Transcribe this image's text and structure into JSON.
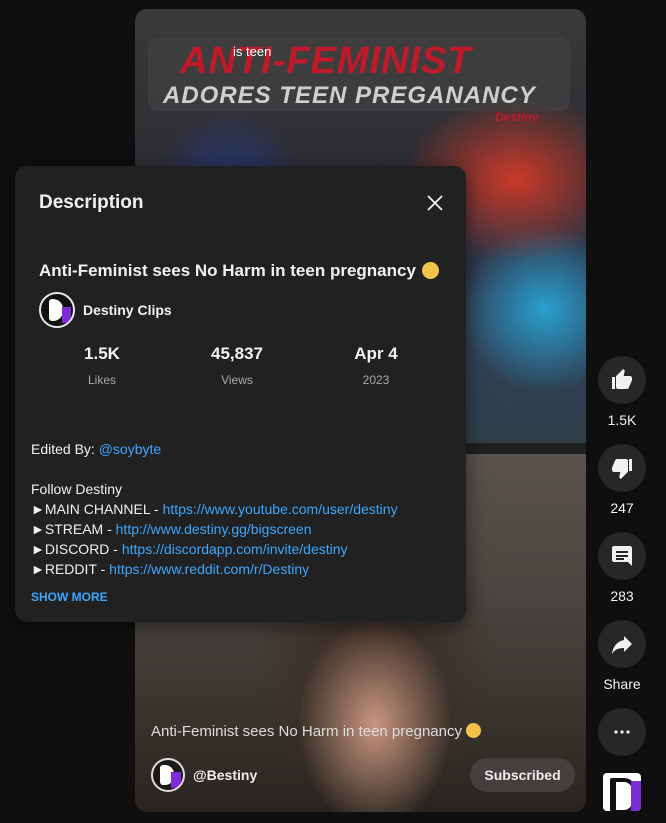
{
  "video": {
    "overlay_small": "is teen",
    "overlay_big": "ANTI-FEMINIST",
    "overlay_big2": "ADORES TEEN PREGANANCY",
    "overlay_tag": "Destiny",
    "title": "Anti-Feminist sees No Harm in teen pregnancy",
    "title_emoji": "baby-emoji",
    "handle": "@Bestiny",
    "subscribe_label": "Subscribed"
  },
  "actions": {
    "like_count": "1.5K",
    "dislike_count": "247",
    "comment_count": "283",
    "share_label": "Share"
  },
  "description": {
    "header": "Description",
    "title": "Anti-Feminist sees No Harm in teen pregnancy",
    "channel_name": "Destiny Clips",
    "stats": [
      {
        "value": "1.5K",
        "label": "Likes"
      },
      {
        "value": "45,837",
        "label": "Views"
      },
      {
        "value": "Apr 4",
        "label": "2023"
      }
    ],
    "edited_by_label": "Edited By: ",
    "edited_by_handle": "@soybyte",
    "follow_heading": "Follow Destiny",
    "links": [
      {
        "prefix": "►MAIN CHANNEL - ",
        "url": "https://www.youtube.com/user/destiny"
      },
      {
        "prefix": "►STREAM - ",
        "url": "http://www.destiny.gg/bigscreen"
      },
      {
        "prefix": "►DISCORD - ",
        "url": "https://discordapp.com/invite/destiny"
      },
      {
        "prefix": "►REDDIT - ",
        "url": "https://www.reddit.com/r/Destiny"
      }
    ],
    "show_more": "SHOW MORE"
  },
  "colors": {
    "link": "#3ea6ff",
    "panel_bg": "#212121",
    "page_bg": "#0f0f0f",
    "brand_accent": "#7c2cd6",
    "overlay_red": "#c01a2a"
  }
}
